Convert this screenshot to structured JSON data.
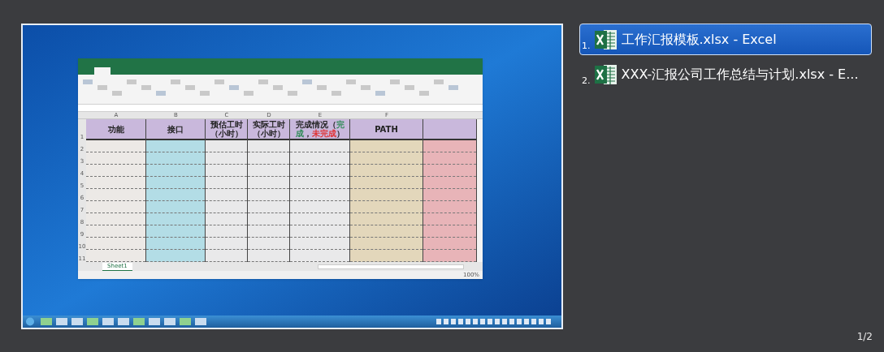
{
  "preview": {
    "sheet": {
      "columns": [
        {
          "letter": "A",
          "color": "#ece9e6",
          "header": [
            {
              "text": "功能"
            }
          ]
        },
        {
          "letter": "B",
          "color": "#b3dde6",
          "header": [
            {
              "text": "接口"
            }
          ]
        },
        {
          "letter": "C",
          "color": "#e9e9ea",
          "header": [
            {
              "text": "预估工时（小时）"
            }
          ]
        },
        {
          "letter": "D",
          "color": "#e9e9ea",
          "header": [
            {
              "text": "实际工时（小时）"
            }
          ]
        },
        {
          "letter": "E",
          "color": "#e9e9ea",
          "header": [
            {
              "text": "完成情况（"
            },
            {
              "text": "完成",
              "color": "#2e8b57"
            },
            {
              "text": "，"
            },
            {
              "text": "未完成",
              "color": "#e03030"
            },
            {
              "text": "）"
            }
          ]
        },
        {
          "letter": "F",
          "color": "#e3d7bb",
          "header": [
            {
              "text": "PATH"
            }
          ]
        },
        {
          "color": "#e8b4b8"
        }
      ],
      "row_numbers": [
        "1",
        "2",
        "3",
        "4",
        "5",
        "6",
        "7",
        "8",
        "9",
        "10",
        "11"
      ],
      "sheet_tab": "Sheet1",
      "zoom": "100%"
    }
  },
  "switcher": {
    "items": [
      {
        "index": "1.",
        "title": "工作汇报模板.xlsx - Excel",
        "selected": true
      },
      {
        "index": "2.",
        "title": "XXX-汇报公司工作总结与计划.xlsx - E...",
        "selected": false
      }
    ],
    "page_counter": "1/2"
  }
}
